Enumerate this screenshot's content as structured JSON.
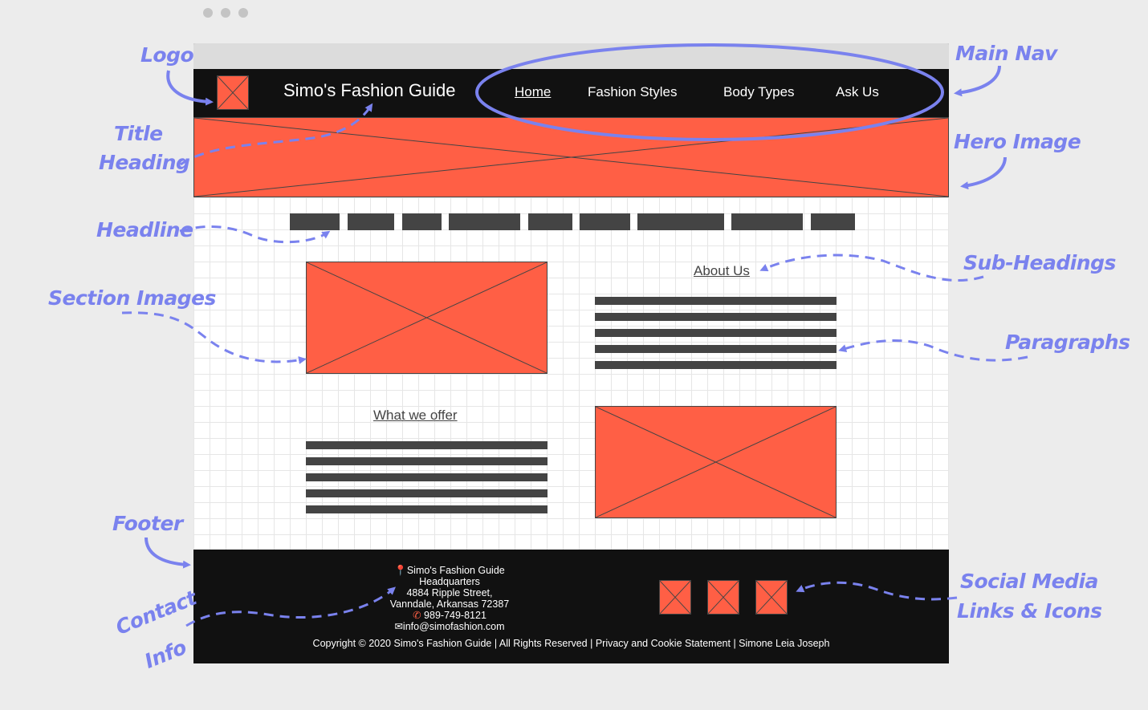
{
  "site": {
    "title": "Simo's Fashion Guide"
  },
  "nav": {
    "items": [
      {
        "label": "Home",
        "active": true
      },
      {
        "label": "Fashion Styles",
        "active": false
      },
      {
        "label": "Body Types",
        "active": false
      },
      {
        "label": "Ask Us",
        "active": false
      }
    ]
  },
  "sections": {
    "about_heading": "About Us",
    "offer_heading": "What we offer"
  },
  "footer": {
    "contact": {
      "line1": "Simo's Fashion Guide",
      "line2": "Headquarters",
      "line3": "4884 Ripple Street,",
      "line4": "Vanndale, Arkansas 72387",
      "phone": "989-749-8121",
      "email": "info@simofashion.com"
    },
    "copyright": "Copyright © 2020 Simo's Fashion Guide | All Rights Reserved | Privacy and Cookie Statement | Simone Leia Joseph"
  },
  "annotations": {
    "logo": "Logo",
    "main_nav": "Main Nav",
    "title_heading_1": "Title",
    "title_heading_2": "Heading",
    "hero_image": "Hero Image",
    "headline": "Headline",
    "sub_headings": "Sub-Headings",
    "section_images": "Section Images",
    "paragraphs": "Paragraphs",
    "footer": "Footer",
    "social_1": "Social Media",
    "social_2": "Links & Icons",
    "contact_1": "Contact",
    "contact_2": "Info"
  },
  "icons": {
    "pin": "map-pin-icon",
    "phone": "phone-icon",
    "email": "envelope-icon"
  },
  "colors": {
    "placeholder": "#ff5f45",
    "dark": "#111111",
    "bar": "#444444",
    "annotation": "#7a82ee",
    "canvas": "#ececec"
  }
}
